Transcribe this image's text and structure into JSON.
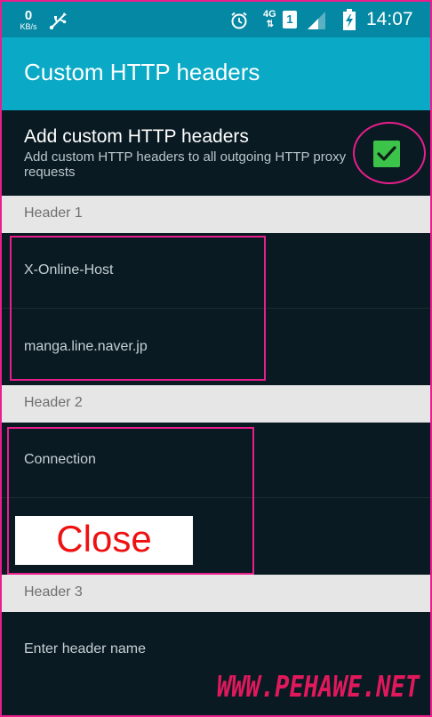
{
  "status_bar": {
    "net_speed_value": "0",
    "net_speed_unit": "KB/s",
    "network_type": "4G",
    "network_arrows": "⇅",
    "sim_slot": "1",
    "time": "14:07",
    "icons": [
      "usb-icon",
      "alarm-icon",
      "signal-icon",
      "battery-charging-icon"
    ]
  },
  "app_bar": {
    "title": "Custom HTTP headers"
  },
  "settings": {
    "toggle": {
      "title": "Add custom HTTP headers",
      "summary": "Add custom HTTP headers to all outgoing HTTP proxy requests",
      "checked": true
    },
    "headers": [
      {
        "label": "Header 1",
        "name": "X-Online-Host",
        "value": "manga.line.naver.jp"
      },
      {
        "label": "Header 2",
        "name": "Connection",
        "value": "Close"
      },
      {
        "label": "Header 3",
        "name_placeholder": "Enter header name"
      }
    ]
  },
  "overlay": {
    "close_label": "Close",
    "watermark": "WWW.PEHAWE.NET"
  },
  "colors": {
    "accent": "#0aa9c6",
    "status_bar": "#0488a3",
    "checkbox": "#3cc44a",
    "highlight": "#e91e8c",
    "background": "#091a22"
  }
}
